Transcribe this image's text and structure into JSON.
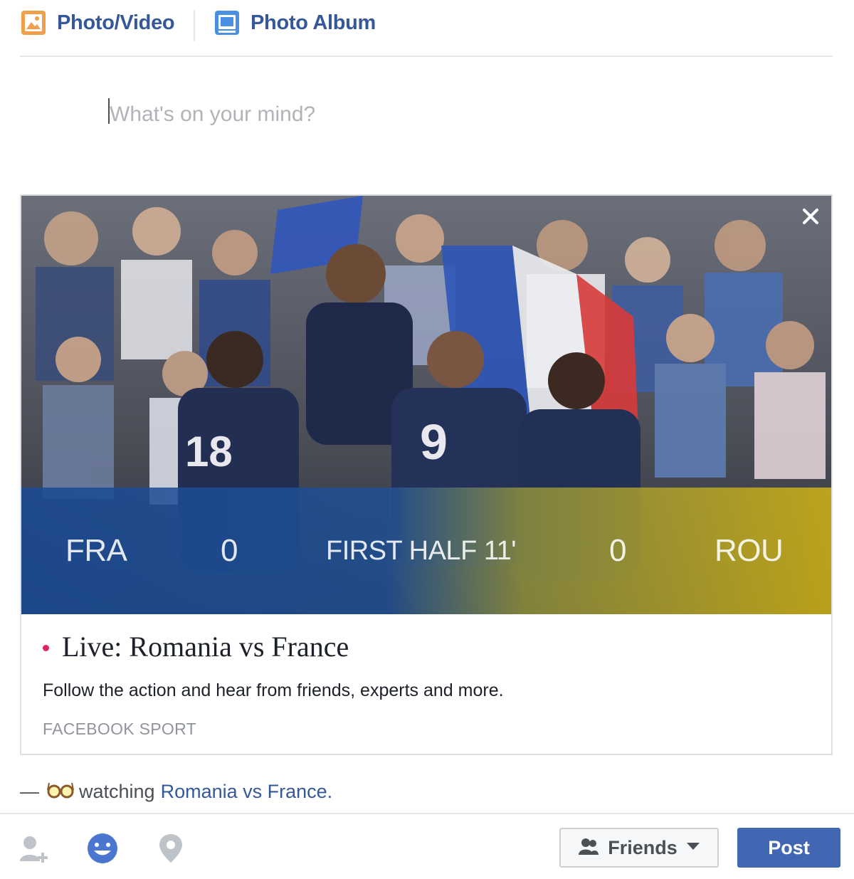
{
  "tabs": [
    {
      "label": "Photo/Video",
      "icon": "photo-icon"
    },
    {
      "label": "Photo Album",
      "icon": "album-icon"
    }
  ],
  "composer": {
    "placeholder": "What's on your mind?"
  },
  "card": {
    "score": {
      "team1": "FRA",
      "score1": "0",
      "period": "FIRST HALF 11'",
      "score2": "0",
      "team2": "ROU"
    },
    "title": "Live: Romania vs France",
    "description": "Follow the action and hear from friends, experts and more.",
    "source": "FACEBOOK SPORT",
    "close_icon": "close-icon"
  },
  "activity": {
    "dash": "—",
    "icon": "glasses-icon",
    "verb": "watching",
    "target": "Romania vs France."
  },
  "toolbar": {
    "icons": [
      "tag-friends-icon",
      "feeling-icon",
      "location-icon"
    ],
    "audience_label": "Friends",
    "post_label": "Post"
  },
  "colors": {
    "link": "#365899",
    "post_button": "#4267b2",
    "live_dot": "#e0245e"
  }
}
